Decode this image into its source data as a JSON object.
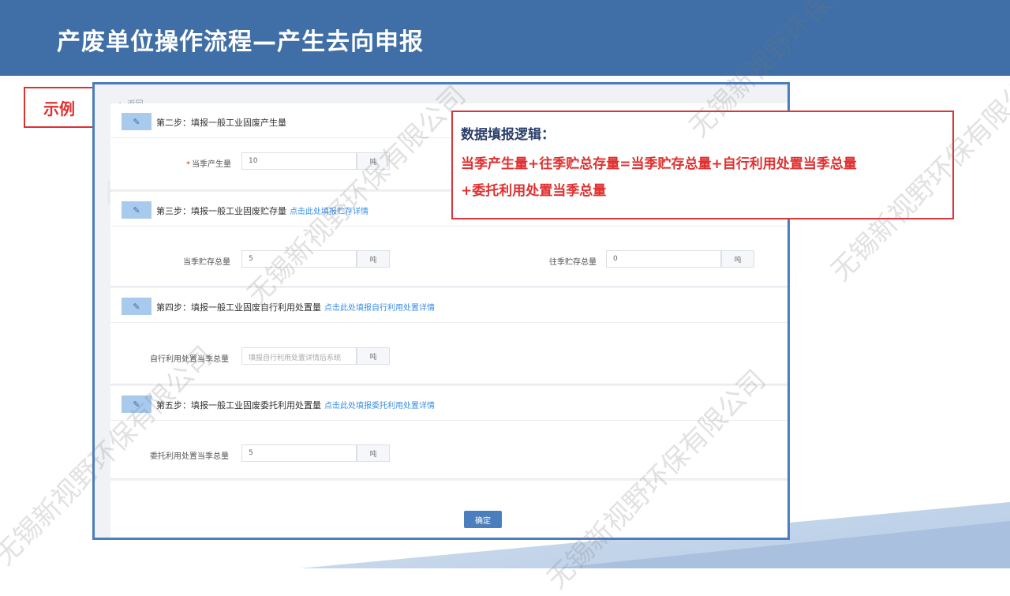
{
  "header": {
    "title": "产废单位操作流程—产生去向申报"
  },
  "example_tag": "示例",
  "form": {
    "back_label": "← 返回",
    "steps": [
      {
        "title": "第二步：填报一般工业固废产生量",
        "link": "",
        "fields": [
          {
            "label": "当季产生量",
            "required": true,
            "value": "10",
            "unit": "吨"
          }
        ]
      },
      {
        "title": "第三步：填报一般工业固废贮存量",
        "link": "点击此处填报贮存详情",
        "fields": [
          {
            "label": "当季贮存总量",
            "required": false,
            "value": "5",
            "unit": "吨"
          },
          {
            "label": "往季贮存总量",
            "required": false,
            "value": "0",
            "unit": "吨"
          }
        ]
      },
      {
        "title": "第四步：填报一般工业固废自行利用处置量",
        "link": "点击此处填报自行利用处置详情",
        "fields": [
          {
            "label": "自行利用处置当季总量",
            "required": false,
            "placeholder": "填报自行利用处置详情后系统",
            "unit": "吨"
          }
        ]
      },
      {
        "title": "第五步：填报一般工业固废委托利用处置量",
        "link": "点击此处填报委托利用处置详情",
        "fields": [
          {
            "label": "委托利用处置当季总量",
            "required": false,
            "value": "5",
            "unit": "吨"
          }
        ]
      }
    ],
    "confirm_label": "确定"
  },
  "logic": {
    "title": "数据填报逻辑：",
    "line1": "当季产生量+往季贮总存量=当季贮存总量+自行利用处置当季总量",
    "line2": "+委托利用处置当季总量"
  },
  "watermark_text": "无锡新视野环保有限公司",
  "colors": {
    "header": "#3f6fa6",
    "accent_red": "#e03030",
    "frame_border": "#4a7ebd",
    "link": "#3a8ee6"
  }
}
